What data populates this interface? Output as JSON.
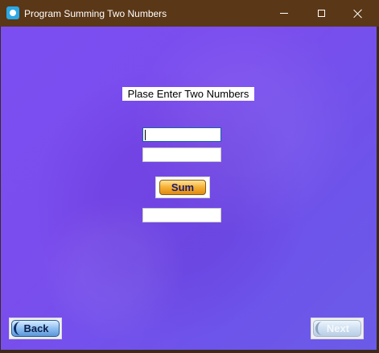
{
  "window": {
    "title": "Program Summing Two Numbers",
    "icon": "app-icon",
    "controls": [
      "minimize-icon",
      "maximize-icon",
      "close-icon"
    ]
  },
  "form": {
    "prompt": "Plase Enter Two Numbers",
    "first_number": {
      "value": "",
      "placeholder": ""
    },
    "second_number": {
      "value": "",
      "placeholder": ""
    },
    "sum_button_label": "Sum",
    "result": {
      "value": "",
      "placeholder": ""
    }
  },
  "navigation": {
    "back_label": "Back",
    "next_label": "Next"
  },
  "colors": {
    "title_bar": "#5a3716",
    "background": "#7b4ef2",
    "sum_button": "#f7b43a",
    "sum_text": "#1a1a6e",
    "nav_button": "#8fc0f2"
  }
}
